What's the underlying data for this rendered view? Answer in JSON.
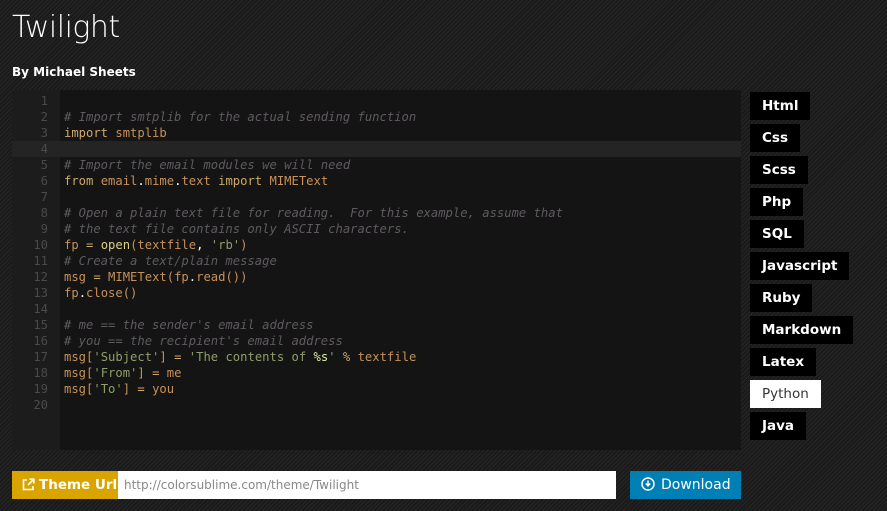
{
  "header": {
    "title": "Twilight",
    "by_prefix": "By ",
    "author": "Michael Sheets"
  },
  "editor": {
    "active_line": 4,
    "lines": [
      {
        "n": "1",
        "tokens": []
      },
      {
        "n": "2",
        "tokens": [
          [
            "c",
            "# Import smtplib for the actual sending function"
          ]
        ]
      },
      {
        "n": "3",
        "tokens": [
          [
            "k",
            "import"
          ],
          [
            "i",
            " smtplib"
          ]
        ]
      },
      {
        "n": "4",
        "tokens": []
      },
      {
        "n": "5",
        "tokens": [
          [
            "c",
            "# Import the email modules we will need"
          ]
        ]
      },
      {
        "n": "6",
        "tokens": [
          [
            "k",
            "from"
          ],
          [
            "i",
            " email"
          ],
          [
            "d",
            "."
          ],
          [
            "i",
            "mime"
          ],
          [
            "d",
            "."
          ],
          [
            "i",
            "text "
          ],
          [
            "k",
            "import"
          ],
          [
            "i",
            " MIMEText"
          ]
        ]
      },
      {
        "n": "7",
        "tokens": []
      },
      {
        "n": "8",
        "tokens": [
          [
            "c",
            "# Open a plain text file for reading.  For this example, assume that"
          ]
        ]
      },
      {
        "n": "9",
        "tokens": [
          [
            "c",
            "# the text file contains only ASCII characters."
          ]
        ]
      },
      {
        "n": "10",
        "tokens": [
          [
            "p",
            "fp "
          ],
          [
            "o",
            "="
          ],
          [
            "p",
            " "
          ],
          [
            "f",
            "open"
          ],
          [
            "p",
            "(textfile"
          ],
          [
            "d",
            ","
          ],
          [
            "p",
            " "
          ],
          [
            "s",
            "'rb'"
          ],
          [
            "p",
            ")"
          ]
        ]
      },
      {
        "n": "11",
        "tokens": [
          [
            "c",
            "# Create a text/plain message"
          ]
        ]
      },
      {
        "n": "12",
        "tokens": [
          [
            "p",
            "msg "
          ],
          [
            "o",
            "="
          ],
          [
            "p",
            " MIMEText(fp"
          ],
          [
            "d",
            "."
          ],
          [
            "p",
            "read())"
          ]
        ]
      },
      {
        "n": "13",
        "tokens": [
          [
            "p",
            "fp"
          ],
          [
            "d",
            "."
          ],
          [
            "p",
            "close()"
          ]
        ]
      },
      {
        "n": "14",
        "tokens": []
      },
      {
        "n": "15",
        "tokens": [
          [
            "c",
            "# me == the sender's email address"
          ]
        ]
      },
      {
        "n": "16",
        "tokens": [
          [
            "c",
            "# you == the recipient's email address"
          ]
        ]
      },
      {
        "n": "17",
        "tokens": [
          [
            "p",
            "msg["
          ],
          [
            "s",
            "'Subject'"
          ],
          [
            "p",
            "] "
          ],
          [
            "o",
            "="
          ],
          [
            "p",
            " "
          ],
          [
            "s",
            "'The contents of "
          ],
          [
            "fmt",
            "%s"
          ],
          [
            "s",
            "'"
          ],
          [
            "p",
            " "
          ],
          [
            "o",
            "%"
          ],
          [
            "p",
            " textfile"
          ]
        ]
      },
      {
        "n": "18",
        "tokens": [
          [
            "p",
            "msg["
          ],
          [
            "s",
            "'From'"
          ],
          [
            "p",
            "] "
          ],
          [
            "o",
            "="
          ],
          [
            "p",
            " me"
          ]
        ]
      },
      {
        "n": "19",
        "tokens": [
          [
            "p",
            "msg["
          ],
          [
            "s",
            "'To'"
          ],
          [
            "p",
            "] "
          ],
          [
            "o",
            "="
          ],
          [
            "p",
            " you"
          ]
        ]
      },
      {
        "n": "20",
        "tokens": []
      }
    ]
  },
  "languages": {
    "active": "Python",
    "items": [
      "Html",
      "Css",
      "Scss",
      "Php",
      "SQL",
      "Javascript",
      "Ruby",
      "Markdown",
      "Latex",
      "Python",
      "Java"
    ]
  },
  "footer": {
    "theme_url_label": "Theme Url",
    "theme_url_icon": "external-link-icon",
    "theme_url_value": "http://colorsublime.com/theme/Twilight",
    "download_label": "Download",
    "download_icon": "download-circle-icon"
  },
  "colors": {
    "theme_url_bg": "#d9a400",
    "download_bg": "#007fb4",
    "editor_bg": "#141414",
    "comment": "#5f5a60",
    "keyword": "#cda869",
    "string": "#8f9d6a"
  }
}
